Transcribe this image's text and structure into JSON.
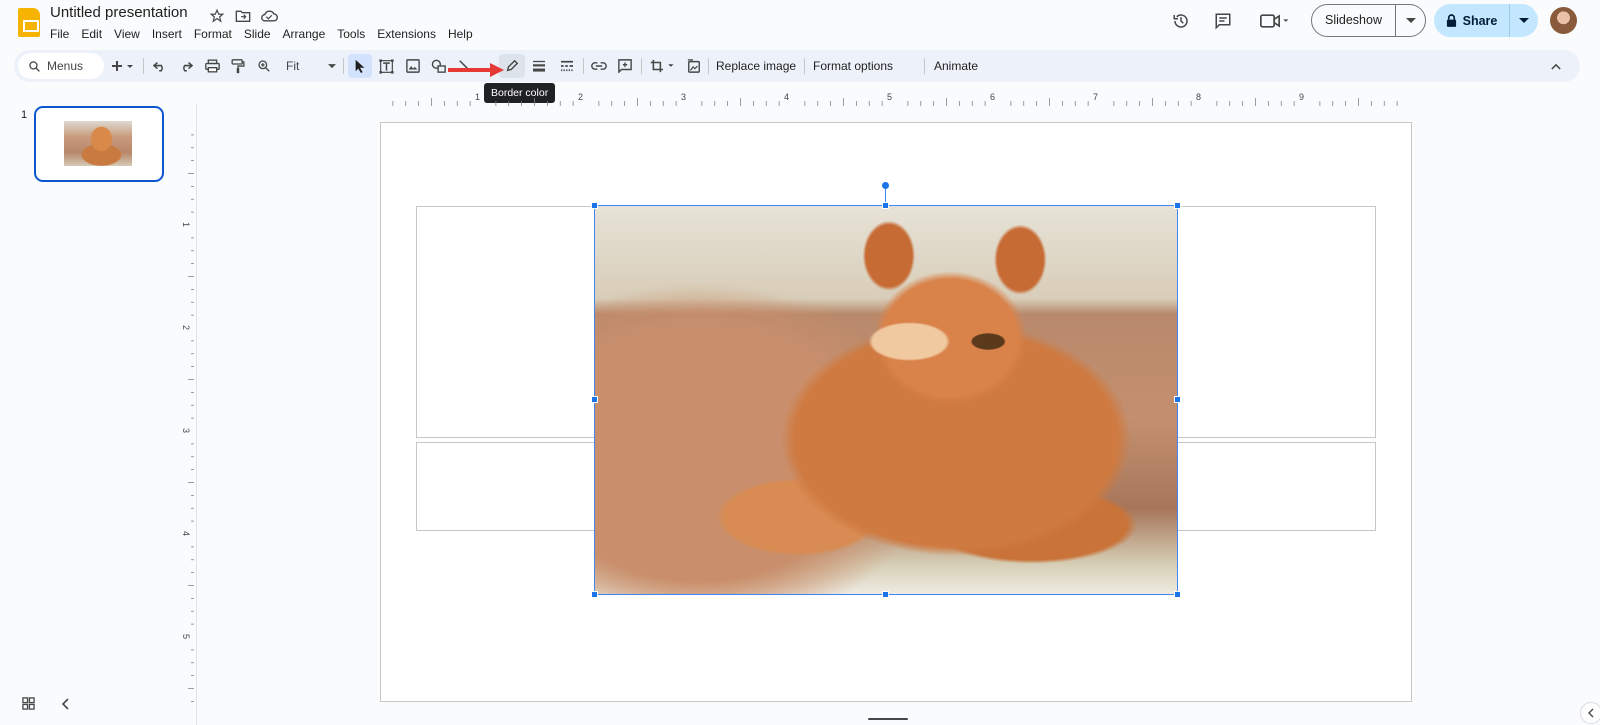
{
  "app": {
    "doc_title": "Untitled presentation",
    "logo_icon": "google-slides-logo"
  },
  "menubar": [
    "File",
    "Edit",
    "View",
    "Insert",
    "Format",
    "Slide",
    "Arrange",
    "Tools",
    "Extensions",
    "Help"
  ],
  "header_actions": {
    "slideshow_label": "Slideshow",
    "share_label": "Share"
  },
  "toolbar": {
    "search_placeholder": "Menus",
    "zoom_value": "Fit",
    "replace_image": "Replace image",
    "format_options": "Format options",
    "animate": "Animate",
    "tooltip": "Border color"
  },
  "ruler": {
    "top_labels": [
      "1",
      "2",
      "3",
      "4",
      "5",
      "6",
      "7",
      "8",
      "9"
    ],
    "left_labels": [
      "1",
      "2",
      "3",
      "4",
      "5"
    ]
  },
  "filmstrip": {
    "slides": [
      {
        "number": "1"
      }
    ]
  },
  "colors": {
    "accent": "#0b57d0",
    "selection": "#1a73e8",
    "share_bg": "#c2e7ff",
    "toolbar_bg": "#edf2fa",
    "annotation_arrow": "#e53935"
  }
}
